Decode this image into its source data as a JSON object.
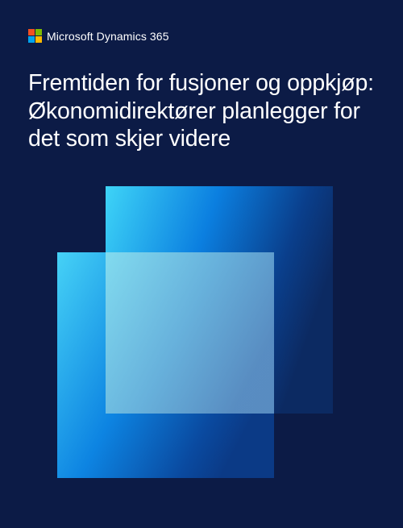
{
  "brand": {
    "name": "Microsoft Dynamics 365",
    "logo_icon": "microsoft-four-square-logo",
    "logo_colors": [
      "#f25022",
      "#7fba00",
      "#00a4ef",
      "#ffb900"
    ]
  },
  "cover": {
    "title": "Fremtiden for fusjoner og oppkjøp: Økonomidirektører planlegger for det som skjer videre",
    "background_color": "#0c1b46",
    "accent_colors": [
      "#3fd0f5",
      "#0a78d8",
      "#0b2a66"
    ]
  }
}
